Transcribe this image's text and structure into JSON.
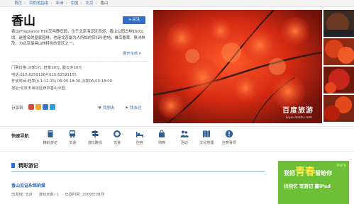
{
  "breadcrumb": {
    "items": [
      "首页",
      "目的地指南",
      "亚洲",
      "中国",
      "北京"
    ],
    "current": "香山"
  },
  "header": {
    "title": "香山",
    "follow_label": "关注"
  },
  "description": {
    "text": "香山(Fragrance Hill)又叫静宜园，位于北京海淀区西郊。香山公园占地160公顷，是著名的皇家园林，也是北京最为人所知的赏红叶胜地，峰峦叠翠、泉沛林茂，为北京最具山林特色的景区之一。",
    "more_label": "展开全部"
  },
  "info": {
    "tickets": "门票价格:淡季5元, 旺季10元, 碧云寺10元",
    "phone": "电话:010-62591264 010-62591155",
    "hours": "开放时间:旺季(4.1-11.15) 06:00-18:30,淡季06:00-18:00",
    "address": "地址:北京市海淀区西郊香山公园"
  },
  "share": {
    "label": "分享到:",
    "icons": [
      {
        "name": "share-sina-icon",
        "color": "#d84a3b"
      },
      {
        "name": "share-qzone-icon",
        "color": "#f0a92a"
      },
      {
        "name": "share-renren-icon",
        "color": "#3a73c2"
      },
      {
        "name": "share-kaixin-icon",
        "color": "#2aa0d8"
      }
    ],
    "like_label": "我想去",
    "been_label": "我去过"
  },
  "photo": {
    "watermark": "百度旅游",
    "watermark_url": "lvyou.baidu.com"
  },
  "quicknav": {
    "label": "快速导航",
    "items": [
      {
        "label": "精彩游记",
        "icon": "book-icon"
      },
      {
        "label": "交通",
        "icon": "bus-icon"
      },
      {
        "label": "游玩路线",
        "icon": "signpost-icon"
      },
      {
        "label": "饮食",
        "icon": "dining-icon"
      },
      {
        "label": "住宿",
        "icon": "bed-icon"
      },
      {
        "label": "购物",
        "icon": "shopping-bag-icon"
      },
      {
        "label": "活动",
        "icon": "people-icon"
      },
      {
        "label": "文化地理",
        "icon": "map-book-icon"
      },
      {
        "label": "注意事项",
        "icon": "warning-icon"
      }
    ]
  },
  "section": {
    "title": "精彩游记"
  },
  "article": {
    "title": "香山见证永恒的爱",
    "from": "出发地: 北京",
    "days": "游玩天数: 1",
    "time": "出发时间: 2009年08月"
  },
  "ad": {
    "prefix": "我把",
    "big": "青春",
    "suffix": "留给你",
    "tag": "YOUTH",
    "line2": "找回忆 写游记 赢iPad"
  },
  "colors": {
    "link": "#3b6fae",
    "accent": "#2f6fc7",
    "autumn_red": "#c8261a"
  }
}
